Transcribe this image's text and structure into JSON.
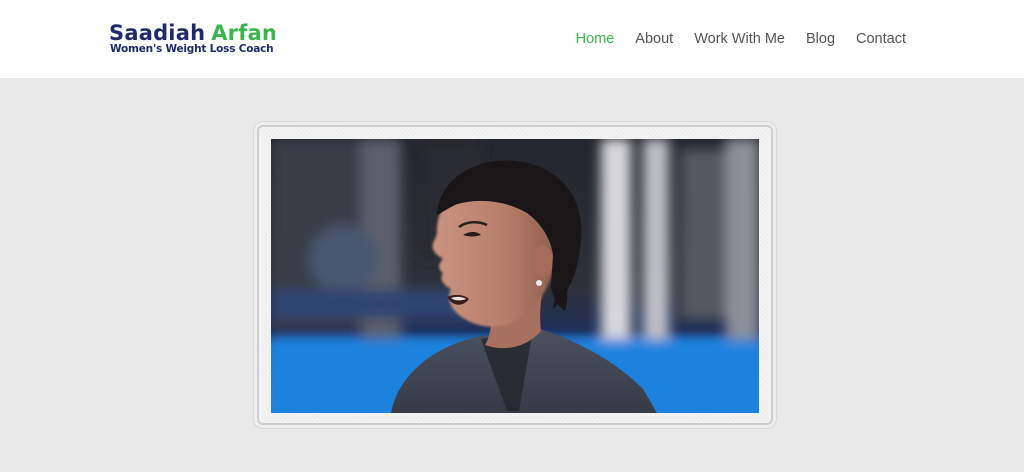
{
  "header": {
    "logo": {
      "first_name": "Saadiah",
      "last_name": "Arfan",
      "tagline": "Women's Weight Loss Coach",
      "colors": {
        "primary": "#1f2a6b",
        "accent": "#3bb54a"
      }
    },
    "nav": {
      "items": [
        {
          "label": "Home",
          "active": true
        },
        {
          "label": "About",
          "active": false
        },
        {
          "label": "Work With Me",
          "active": false
        },
        {
          "label": "Blog",
          "active": false
        },
        {
          "label": "Contact",
          "active": false
        }
      ],
      "active_color": "#3bb54a",
      "text_color": "#555555"
    }
  },
  "hero": {
    "image_subject": "woman-portrait-icon"
  },
  "colors": {
    "page_background": "#e8e8e8",
    "header_background": "#ffffff"
  }
}
